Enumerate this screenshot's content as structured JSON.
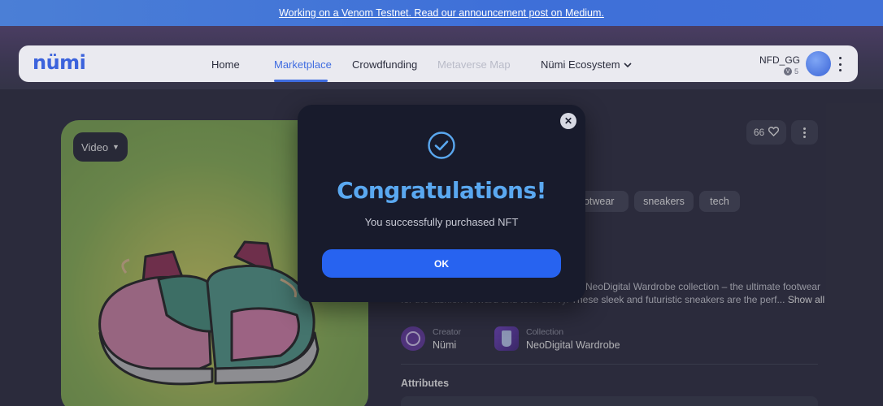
{
  "announcement": {
    "text": "Working on a Venom Testnet. Read our announcement post on Medium."
  },
  "navbar": {
    "logo": "nümi",
    "items": [
      {
        "label": "Home"
      },
      {
        "label": "Marketplace"
      },
      {
        "label": "Crowdfunding"
      },
      {
        "label": "Metaverse Map"
      },
      {
        "label": "Nümi Ecosystem"
      }
    ],
    "active_item": "Marketplace",
    "disabled_item": "Metaverse Map",
    "user": {
      "name": "NFD_GG",
      "balance": "5"
    }
  },
  "media": {
    "view_selector": "Video"
  },
  "item": {
    "likes": "66",
    "tags": [
      "footwear",
      "sneakers",
      "tech"
    ],
    "description_line1": "NeoDigital Wardrobe collection – the ultimate footwear",
    "description_line2_faded": "for the fashion-forward and tech-savvy. ",
    "description_line2": "These sleek and futuristic sneakers are the perf...",
    "show_all": "Show all",
    "creator": {
      "label": "Creator",
      "value": "Nümi"
    },
    "collection": {
      "label": "Collection",
      "value": "NeoDigital Wardrobe"
    },
    "attributes_title": "Attributes"
  },
  "modal": {
    "title": "Congratulations!",
    "message": "You successfully purchased NFT",
    "ok_label": "OK"
  },
  "colors": {
    "accent": "#3f6ce0",
    "modal_title": "#5aa8f0",
    "ok_button": "#2763f0",
    "announcement_bar": "#4272d8"
  }
}
